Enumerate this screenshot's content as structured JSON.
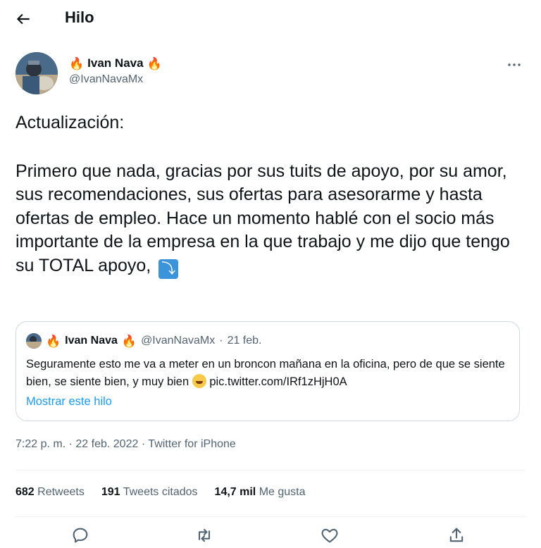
{
  "header": {
    "title": "Hilo"
  },
  "author": {
    "name": "Ivan Nava",
    "handle": "@IvanNavaMx",
    "badge_emoji": "🔥"
  },
  "tweet": {
    "heading": "Actualización:",
    "body": "Primero que nada, gracias por sus tuits de apoyo, por su amor, sus recomendaciones, sus ofertas para asesorarme y hasta ofertas de empleo. Hace un momento hablé con el socio más importante de la empresa en la que trabajo y me dijo que tengo su TOTAL apoyo,",
    "arrow_emoji": "⤵"
  },
  "quote": {
    "name": "Ivan Nava",
    "handle": "@IvanNavaMx",
    "separator": "·",
    "date": "21 feb.",
    "text_before": "Seguramente esto me va a meter en un broncon mañana en la oficina, pero de que se siente bien, se siente bien, y muy bien",
    "text_after": "pic.twitter.com/IRf1zHjH0A",
    "show_thread": "Mostrar este hilo"
  },
  "meta": {
    "time": "7:22 p. m.",
    "separator": "·",
    "date": "22 feb. 2022",
    "source": "Twitter for iPhone"
  },
  "stats": {
    "retweets_count": "682",
    "retweets_label": "Retweets",
    "quotes_count": "191",
    "quotes_label": "Tweets citados",
    "likes_count": "14,7 mil",
    "likes_label": "Me gusta"
  }
}
